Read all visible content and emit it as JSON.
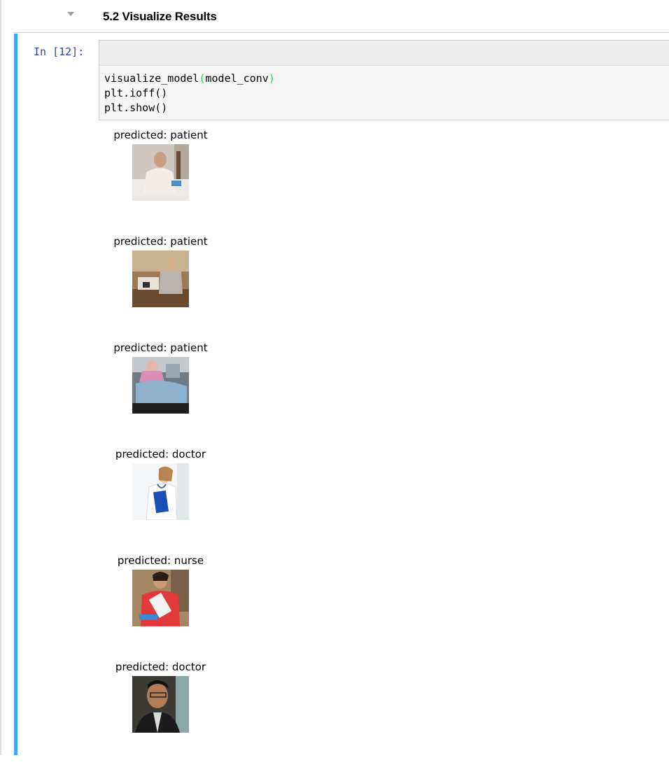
{
  "section": {
    "title": "5.2 Visualize Results"
  },
  "cell": {
    "prompt": "In [12]:",
    "code": [
      {
        "pre": "visualize_model",
        "open": "(",
        "mid": "model_conv",
        "close": ")"
      },
      {
        "text": "plt.ioff()"
      },
      {
        "text": "plt.show()"
      }
    ]
  },
  "outputs": [
    {
      "label": "predicted: patient",
      "image": "patient-in-hospital-bed-photo"
    },
    {
      "label": "predicted: patient",
      "image": "patient-with-caregiver-photo"
    },
    {
      "label": "predicted: patient",
      "image": "patient-on-stretcher-photo"
    },
    {
      "label": "predicted: doctor",
      "image": "female-doctor-with-clipboard-photo"
    },
    {
      "label": "predicted: nurse",
      "image": "nurse-in-red-vest-photo"
    },
    {
      "label": "predicted: doctor",
      "image": "male-doctor-portrait-photo"
    }
  ]
}
